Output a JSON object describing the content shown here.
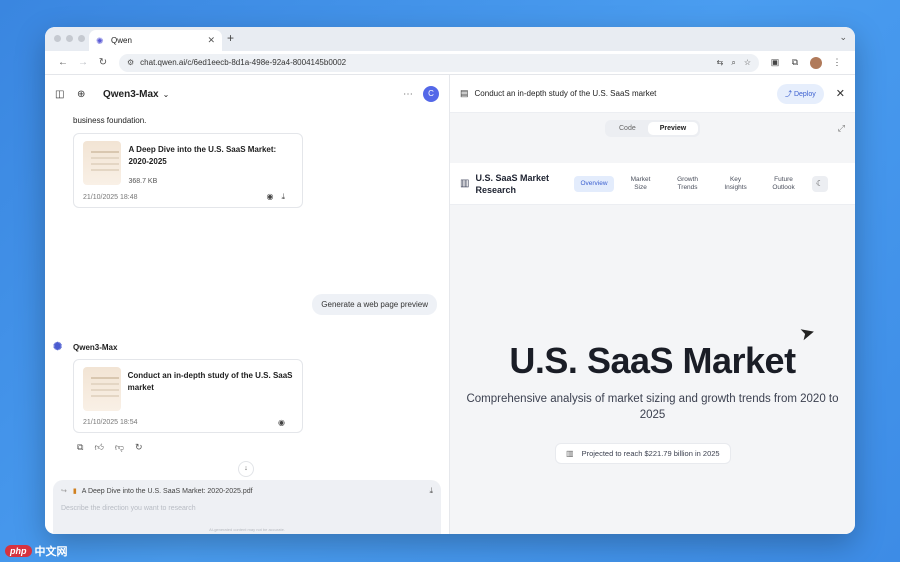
{
  "browser": {
    "tab_title": "Qwen",
    "new_tab": "+",
    "url": "chat.qwen.ai/c/6ed1eecb-8d1a-498e-92a4-8004145b0002"
  },
  "left": {
    "model": "Qwen3-Max",
    "user_initial": "C",
    "prev_msg_tail": "business foundation.",
    "card1": {
      "title": "A Deep Dive into the U.S. SaaS Market: 2020-2025",
      "size": "368.7 KB",
      "time": "21/10/2025 18:48"
    },
    "user_msg": "Generate a web page preview",
    "bot_name": "Qwen3-Max",
    "card2": {
      "title": "Conduct an in-depth study of the U.S. SaaS market",
      "time": "21/10/2025 18:54"
    },
    "composer": {
      "attachment": "A Deep Dive into the U.S. SaaS Market: 2020-2025.pdf",
      "placeholder": "Describe the direction you want to research",
      "disclaimer": "AI-generated content may not be accurate."
    }
  },
  "right": {
    "title": "Conduct an in-depth study of the U.S. SaaS market",
    "deploy": "Deploy",
    "toggle": [
      "Code",
      "Preview"
    ],
    "site": {
      "brand": "U.S. SaaS Market Research",
      "nav": [
        "Overview",
        "Market Size",
        "Growth Trends",
        "Key Insights",
        "Future Outlook"
      ],
      "hero": "U.S. SaaS Market",
      "subtitle": "Comprehensive analysis of market sizing and growth trends from 2020 to 2025",
      "projection": "Projected to reach $221.79 billion in 2025"
    }
  },
  "watermark": {
    "logo": "php",
    "text": "中文网"
  },
  "colors": {
    "accent": "#3b5fcf",
    "background": "#3a86e0",
    "user_avatar": "#5468e8"
  }
}
